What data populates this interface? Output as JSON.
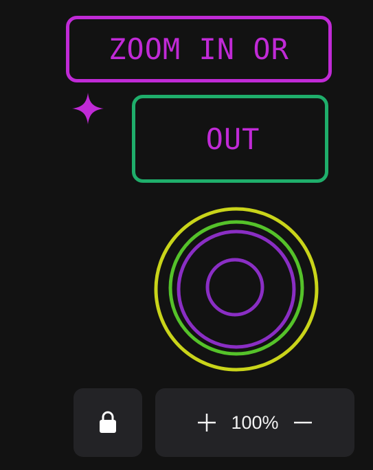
{
  "canvas": {
    "top_box_text": "ZOOM IN OR",
    "bottom_box_text": "OUT",
    "colors": {
      "background": "#121212",
      "magenta": "#c02ad6",
      "green": "#1fae6b",
      "ring_yellow": "#c9d41a",
      "ring_green": "#55c22a",
      "ring_purple": "#8a2ec4"
    }
  },
  "toolbar": {
    "lock_icon": "lock-icon",
    "zoom_in_icon": "plus-icon",
    "zoom_out_icon": "minus-icon",
    "zoom_level": "100%",
    "colors": {
      "panel": "#232326",
      "text": "#f2f2f2"
    }
  }
}
